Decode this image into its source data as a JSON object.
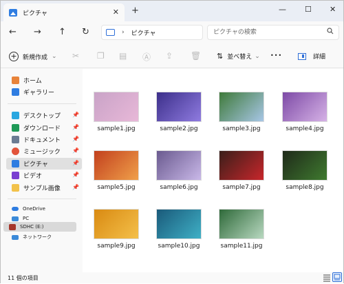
{
  "window": {
    "tab_title": "ピクチャ",
    "tab_close": "✕",
    "new_tab": "+",
    "minimize": "—",
    "maximize": "☐",
    "close": "✕"
  },
  "nav": {
    "back": "←",
    "forward": "→",
    "up": "↑",
    "refresh": "↻",
    "path_sep": "›",
    "path": "ピクチャ",
    "search_placeholder": "ピクチャの検索"
  },
  "commands": {
    "new_label": "新規作成",
    "new_arrow": "⌄",
    "sort_label": "並べ替え",
    "sort_arrow": "⌄",
    "more": "•••",
    "details_label": "詳細"
  },
  "sidebar": {
    "quick": [
      {
        "label": "ホーム",
        "icon": "home-icon",
        "color": "#e8833a"
      },
      {
        "label": "ギャラリー",
        "icon": "gallery-icon",
        "color": "#2f7de1"
      }
    ],
    "pinned": [
      {
        "label": "デスクトップ",
        "icon": "desktop-icon",
        "color": "#2aa7e0"
      },
      {
        "label": "ダウンロード",
        "icon": "download-icon",
        "color": "#1f9a57"
      },
      {
        "label": "ドキュメント",
        "icon": "documents-icon",
        "color": "#6b7c93"
      },
      {
        "label": "ミュージック",
        "icon": "music-icon",
        "color": "#e2543b"
      },
      {
        "label": "ピクチャ",
        "icon": "pictures-icon",
        "color": "#2f7de1"
      },
      {
        "label": "ビデオ",
        "icon": "videos-icon",
        "color": "#7a3fd1"
      },
      {
        "label": "サンプル画像",
        "icon": "folder-icon",
        "color": "#f2c24b"
      }
    ],
    "devices": [
      {
        "label": "OneDrive",
        "icon": "onedrive-icon",
        "color": "#2f7de1"
      },
      {
        "label": "PC",
        "icon": "pc-icon",
        "color": "#3b8ad9"
      },
      {
        "label": "SDHC (E:)",
        "icon": "sd-card-icon",
        "color": "#a5352a"
      },
      {
        "label": "ネットワーク",
        "icon": "network-icon",
        "color": "#3b8ad9"
      }
    ],
    "pin_glyph": "📌"
  },
  "files": [
    {
      "name": "sample1.jpg",
      "c1": "#c9a3c7",
      "c2": "#e8b8d8"
    },
    {
      "name": "sample2.jpg",
      "c1": "#3c2f8a",
      "c2": "#8f7be0"
    },
    {
      "name": "sample3.jpg",
      "c1": "#3f7a3a",
      "c2": "#a7c6e6"
    },
    {
      "name": "sample4.jpg",
      "c1": "#7d4aa6",
      "c2": "#d6b2e6"
    },
    {
      "name": "sample5.jpg",
      "c1": "#c2401e",
      "c2": "#f0a04a"
    },
    {
      "name": "sample6.jpg",
      "c1": "#6a5a8f",
      "c2": "#c9b8e8"
    },
    {
      "name": "sample7.jpg",
      "c1": "#3a1f1a",
      "c2": "#c8262b"
    },
    {
      "name": "sample8.jpg",
      "c1": "#1f2a1a",
      "c2": "#3f7a2f"
    },
    {
      "name": "sample9.jpg",
      "c1": "#d98a12",
      "c2": "#f4c04a"
    },
    {
      "name": "sample10.jpg",
      "c1": "#1a5a7a",
      "c2": "#3fb0c6"
    },
    {
      "name": "sample11.jpg",
      "c1": "#2f6a3a",
      "c2": "#b8d8c0"
    }
  ],
  "status": {
    "count": "11 個の項目"
  },
  "colors": {
    "accent": "#2f6fd8",
    "selection": "#e0e0e0"
  }
}
